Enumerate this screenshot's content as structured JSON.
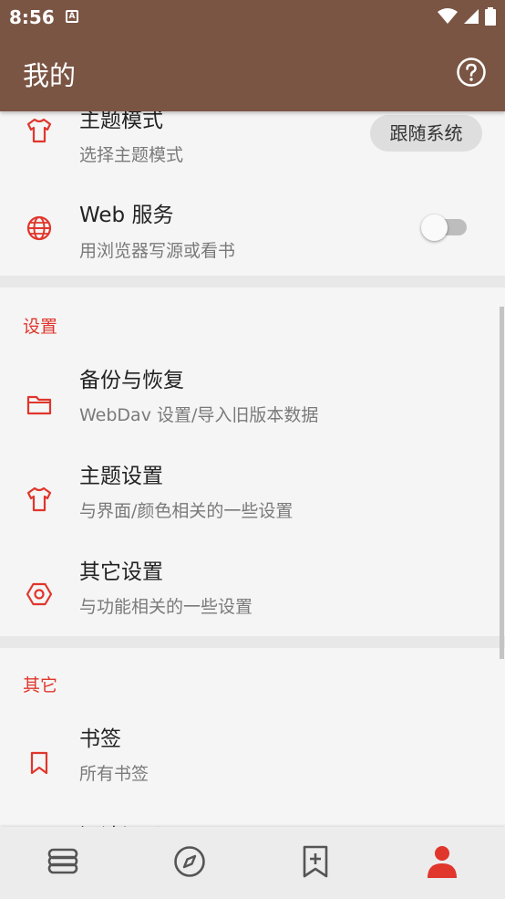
{
  "status_bar": {
    "time": "8:56",
    "notification_letter": "A"
  },
  "app_bar": {
    "title": "我的",
    "help_icon": "help-circle-icon"
  },
  "theme_mode": {
    "title": "主题模式",
    "subtitle": "选择主题模式",
    "value": "跟随系统",
    "icon": "tshirt-icon"
  },
  "web_service": {
    "title": "Web 服务",
    "subtitle": "用浏览器写源或看书",
    "enabled": false,
    "icon": "globe-icon"
  },
  "settings_section": {
    "header": "设置",
    "items": [
      {
        "title": "备份与恢复",
        "subtitle": "WebDav 设置/导入旧版本数据",
        "icon": "folder-icon"
      },
      {
        "title": "主题设置",
        "subtitle": "与界面/颜色相关的一些设置",
        "icon": "tshirt-icon"
      },
      {
        "title": "其它设置",
        "subtitle": "与功能相关的一些设置",
        "icon": "hexagon-settings-icon"
      }
    ]
  },
  "other_section": {
    "header": "其它",
    "items": [
      {
        "title": "书签",
        "subtitle": "所有书签",
        "icon": "bookmark-icon"
      },
      {
        "title": "阅读记录",
        "icon": "history-icon"
      }
    ]
  },
  "bottom_nav": [
    {
      "name": "bookshelf",
      "icon": "stack-icon",
      "active": false
    },
    {
      "name": "explore",
      "icon": "compass-icon",
      "active": false
    },
    {
      "name": "rss",
      "icon": "bookmark-plus-icon",
      "active": false
    },
    {
      "name": "my",
      "icon": "person-icon",
      "active": true
    }
  ],
  "colors": {
    "primary": "#7b5544",
    "accent": "#e0362c",
    "background": "#f3f3f3"
  }
}
